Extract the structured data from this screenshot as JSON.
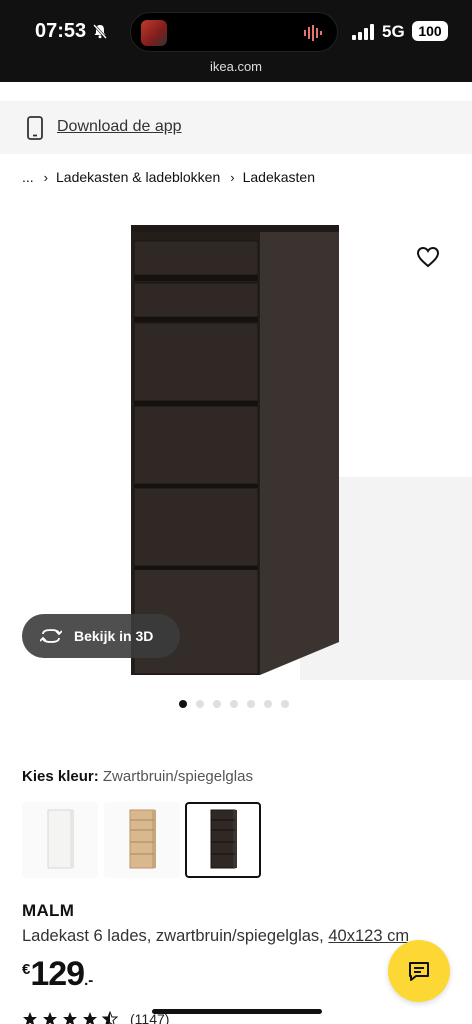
{
  "status_bar": {
    "time": "07:53",
    "network": "5G",
    "battery": "100",
    "url": "ikea.com"
  },
  "app_banner": {
    "label": "Download de app"
  },
  "breadcrumb": {
    "ellipsis": "...",
    "items": [
      "Ladekasten & ladeblokken",
      "Ladekasten"
    ]
  },
  "gallery": {
    "view3d_label": "Bekijk in 3D",
    "total_images": 7,
    "active_index": 0
  },
  "color": {
    "label": "Kies kleur:",
    "selected": "Zwartbruin/spiegelglas",
    "options": [
      "white",
      "white-stained-oak",
      "black-brown"
    ],
    "selected_index": 2
  },
  "product": {
    "name": "MALM",
    "description": "Ladekast 6 lades, zwartbruin/spiegelglas,",
    "dimensions": "40x123 cm",
    "price_currency": "€",
    "price_whole": "129",
    "price_decimal": ".-",
    "rating_stars": 4.5,
    "review_count": "(1147)"
  },
  "icons": {
    "bell": "bell-slash-icon",
    "phone": "phone-icon",
    "heart": "heart-icon",
    "rotate": "rotate-3d-icon",
    "chat": "chat-icon"
  },
  "colors": {
    "accent": "#fdd835",
    "dark": "#111111",
    "dresser": "#2c2522"
  }
}
